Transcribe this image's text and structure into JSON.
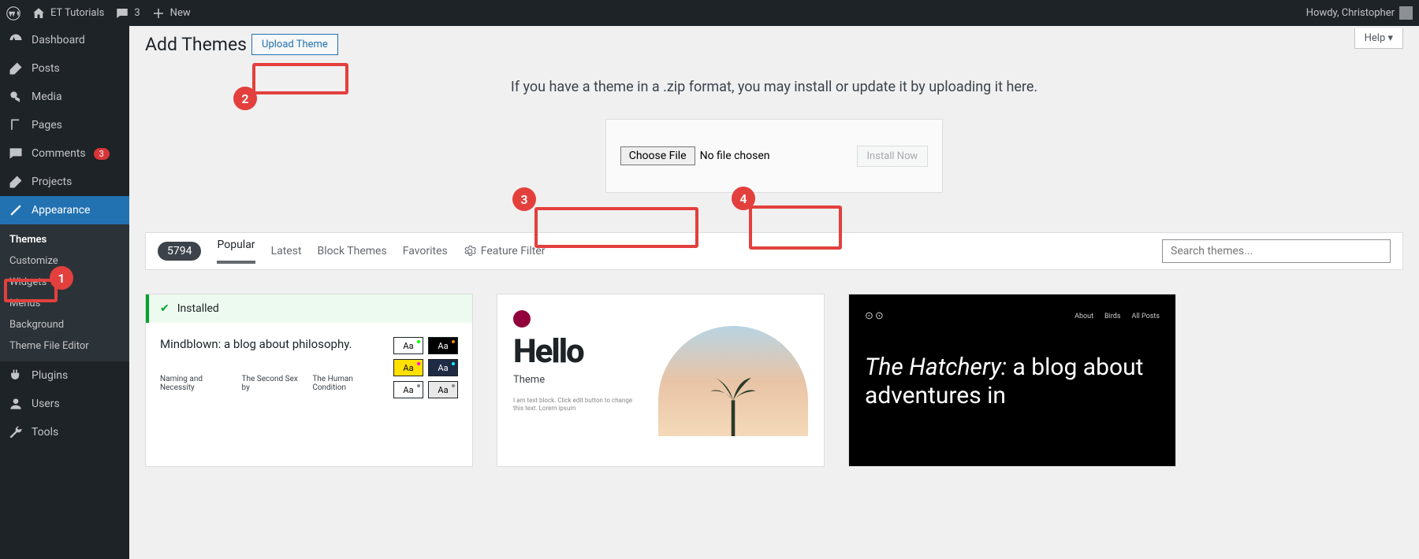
{
  "adminbar": {
    "site_name": "ET Tutorials",
    "comments_count": "3",
    "new_label": "New",
    "howdy": "Howdy, Christopher"
  },
  "sidebar": {
    "dashboard": "Dashboard",
    "posts": "Posts",
    "media": "Media",
    "pages": "Pages",
    "comments": "Comments",
    "comments_count": "3",
    "projects": "Projects",
    "appearance": "Appearance",
    "submenu": {
      "themes": "Themes",
      "customize": "Customize",
      "widgets": "Widgets",
      "menus": "Menus",
      "background": "Background",
      "theme_file_editor": "Theme File Editor"
    },
    "plugins": "Plugins",
    "users": "Users",
    "tools": "Tools"
  },
  "page": {
    "title": "Add Themes",
    "upload_theme": "Upload Theme",
    "help": "Help",
    "upload_hint": "If you have a theme in a .zip format, you may install or update it by uploading it here.",
    "choose_file": "Choose File",
    "no_file": "No file chosen",
    "install_now": "Install Now"
  },
  "filters": {
    "count": "5794",
    "popular": "Popular",
    "latest": "Latest",
    "block_themes": "Block Themes",
    "favorites": "Favorites",
    "feature_filter": "Feature Filter",
    "search_placeholder": "Search themes..."
  },
  "themes": {
    "installed": "Installed",
    "theme1": {
      "title": "Mindblown: a blog about philosophy.",
      "link1": "Naming and Necessity",
      "link2": "The Second Sex by",
      "link3": "The Human Condition",
      "aa": "Aa"
    },
    "theme2": {
      "hello": "Hello",
      "subtitle": "Theme",
      "lorem": "I am text block. Click edit button to change this text. Lorem ipsum"
    },
    "theme3": {
      "logo": "⊙⊙",
      "nav1": "About",
      "nav2": "Birds",
      "nav3": "All Posts",
      "title_italic": "The Hatchery:",
      "title_rest": " a blog about adventures in"
    }
  },
  "callouts": {
    "c1": "1",
    "c2": "2",
    "c3": "3",
    "c4": "4"
  }
}
